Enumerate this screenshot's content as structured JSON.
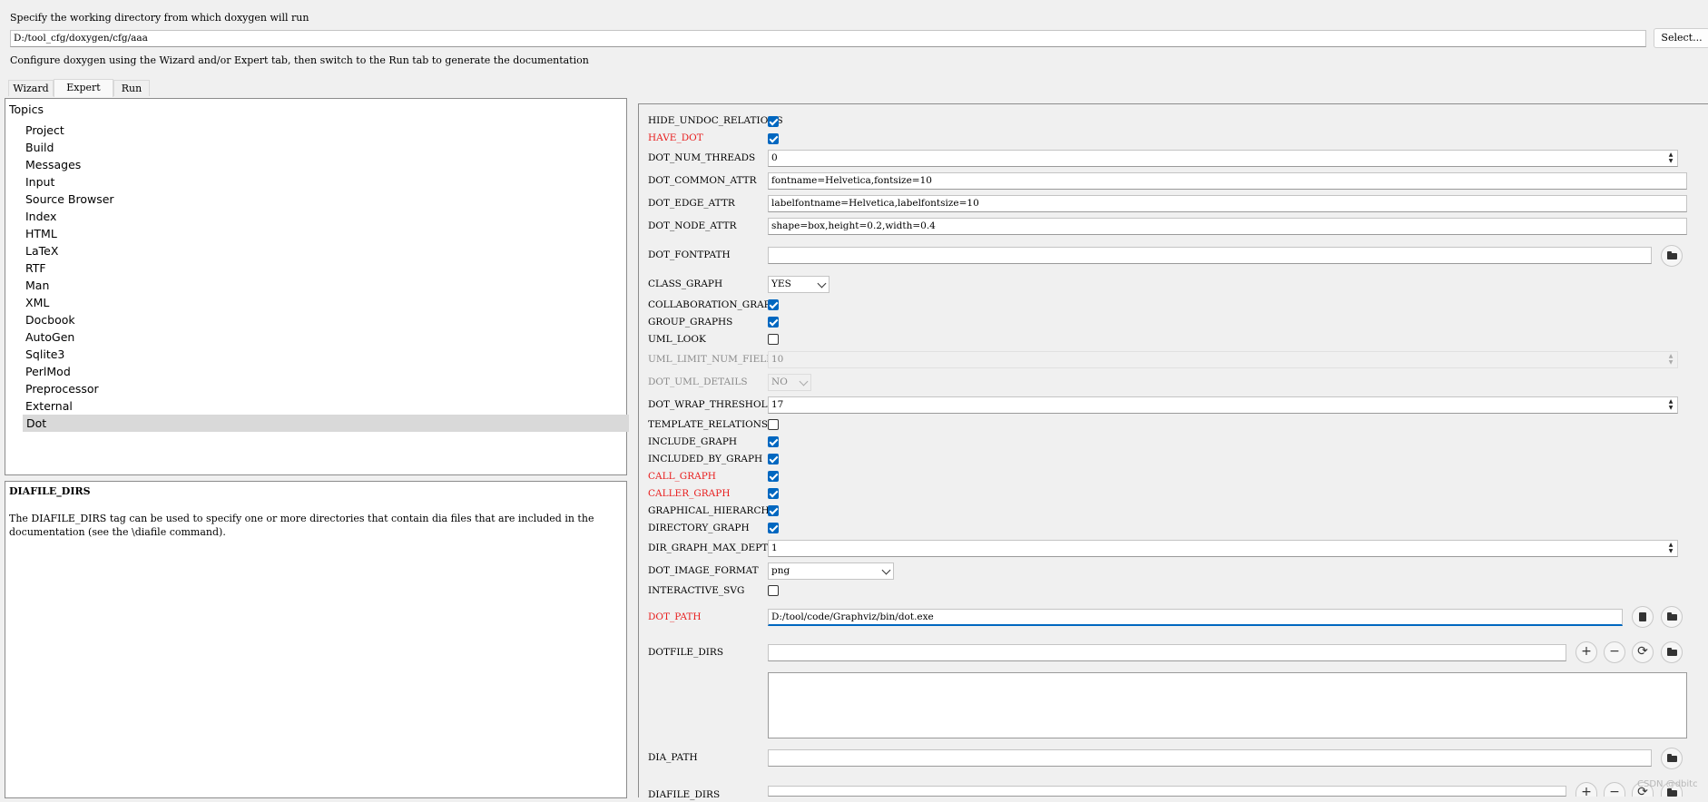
{
  "header": {
    "workdir_label": "Specify the working directory from which doxygen will run",
    "workdir_value": "D:/tool_cfg/doxygen/cfg/aaa",
    "select_button": "Select...",
    "info_text": "Configure doxygen using the Wizard and/or Expert tab, then switch to the Run tab to generate the documentation"
  },
  "tabs": {
    "wizard": "Wizard",
    "expert": "Expert",
    "run": "Run",
    "active": "Expert"
  },
  "topics": {
    "heading": "Topics",
    "items": [
      "Project",
      "Build",
      "Messages",
      "Input",
      "Source Browser",
      "Index",
      "HTML",
      "LaTeX",
      "RTF",
      "Man",
      "XML",
      "Docbook",
      "AutoGen",
      "Sqlite3",
      "PerlMod",
      "Preprocessor",
      "External",
      "Dot"
    ],
    "selected": "Dot"
  },
  "help": {
    "title": "DIAFILE_DIRS",
    "text": "The DIAFILE_DIRS tag can be used to specify one or more directories that contain dia files that are included in the documentation (see the \\diafile command)."
  },
  "settings": {
    "hide_undoc_relations": {
      "label": "HIDE_UNDOC_RELATIONS",
      "checked": true
    },
    "have_dot": {
      "label": "HAVE_DOT",
      "checked": true
    },
    "dot_num_threads": {
      "label": "DOT_NUM_THREADS",
      "value": "0"
    },
    "dot_common_attr": {
      "label": "DOT_COMMON_ATTR",
      "value": "fontname=Helvetica,fontsize=10"
    },
    "dot_edge_attr": {
      "label": "DOT_EDGE_ATTR",
      "value": "labelfontname=Helvetica,labelfontsize=10"
    },
    "dot_node_attr": {
      "label": "DOT_NODE_ATTR",
      "value": "shape=box,height=0.2,width=0.4"
    },
    "dot_fontpath": {
      "label": "DOT_FONTPATH",
      "value": ""
    },
    "class_graph": {
      "label": "CLASS_GRAPH",
      "value": "YES"
    },
    "collaboration_graph": {
      "label": "COLLABORATION_GRAPH",
      "checked": true
    },
    "group_graphs": {
      "label": "GROUP_GRAPHS",
      "checked": true
    },
    "uml_look": {
      "label": "UML_LOOK",
      "checked": false
    },
    "uml_limit_num_fields": {
      "label": "UML_LIMIT_NUM_FIELDS",
      "value": "10"
    },
    "dot_uml_details": {
      "label": "DOT_UML_DETAILS",
      "value": "NO"
    },
    "dot_wrap_threshold": {
      "label": "DOT_WRAP_THRESHOLD",
      "value": "17"
    },
    "template_relations": {
      "label": "TEMPLATE_RELATIONS",
      "checked": false
    },
    "include_graph": {
      "label": "INCLUDE_GRAPH",
      "checked": true
    },
    "included_by_graph": {
      "label": "INCLUDED_BY_GRAPH",
      "checked": true
    },
    "call_graph": {
      "label": "CALL_GRAPH",
      "checked": true
    },
    "caller_graph": {
      "label": "CALLER_GRAPH",
      "checked": true
    },
    "graphical_hierarchy": {
      "label": "GRAPHICAL_HIERARCHY",
      "checked": true
    },
    "directory_graph": {
      "label": "DIRECTORY_GRAPH",
      "checked": true
    },
    "dir_graph_max_depth": {
      "label": "DIR_GRAPH_MAX_DEPTH",
      "value": "1"
    },
    "dot_image_format": {
      "label": "DOT_IMAGE_FORMAT",
      "value": "png"
    },
    "interactive_svg": {
      "label": "INTERACTIVE_SVG",
      "checked": false
    },
    "dot_path": {
      "label": "DOT_PATH",
      "value": "D:/tool/code/Graphviz/bin/dot.exe"
    },
    "dotfile_dirs": {
      "label": "DOTFILE_DIRS",
      "value": ""
    },
    "dia_path": {
      "label": "DIA_PATH",
      "value": ""
    },
    "diafile_dirs": {
      "label": "DIAFILE_DIRS",
      "value": ""
    }
  },
  "watermark": "CSDN @dbitc",
  "colors": {
    "accent": "#0067c0",
    "modified_label": "#e81c1c",
    "disabled_label": "#8a8a8a"
  }
}
